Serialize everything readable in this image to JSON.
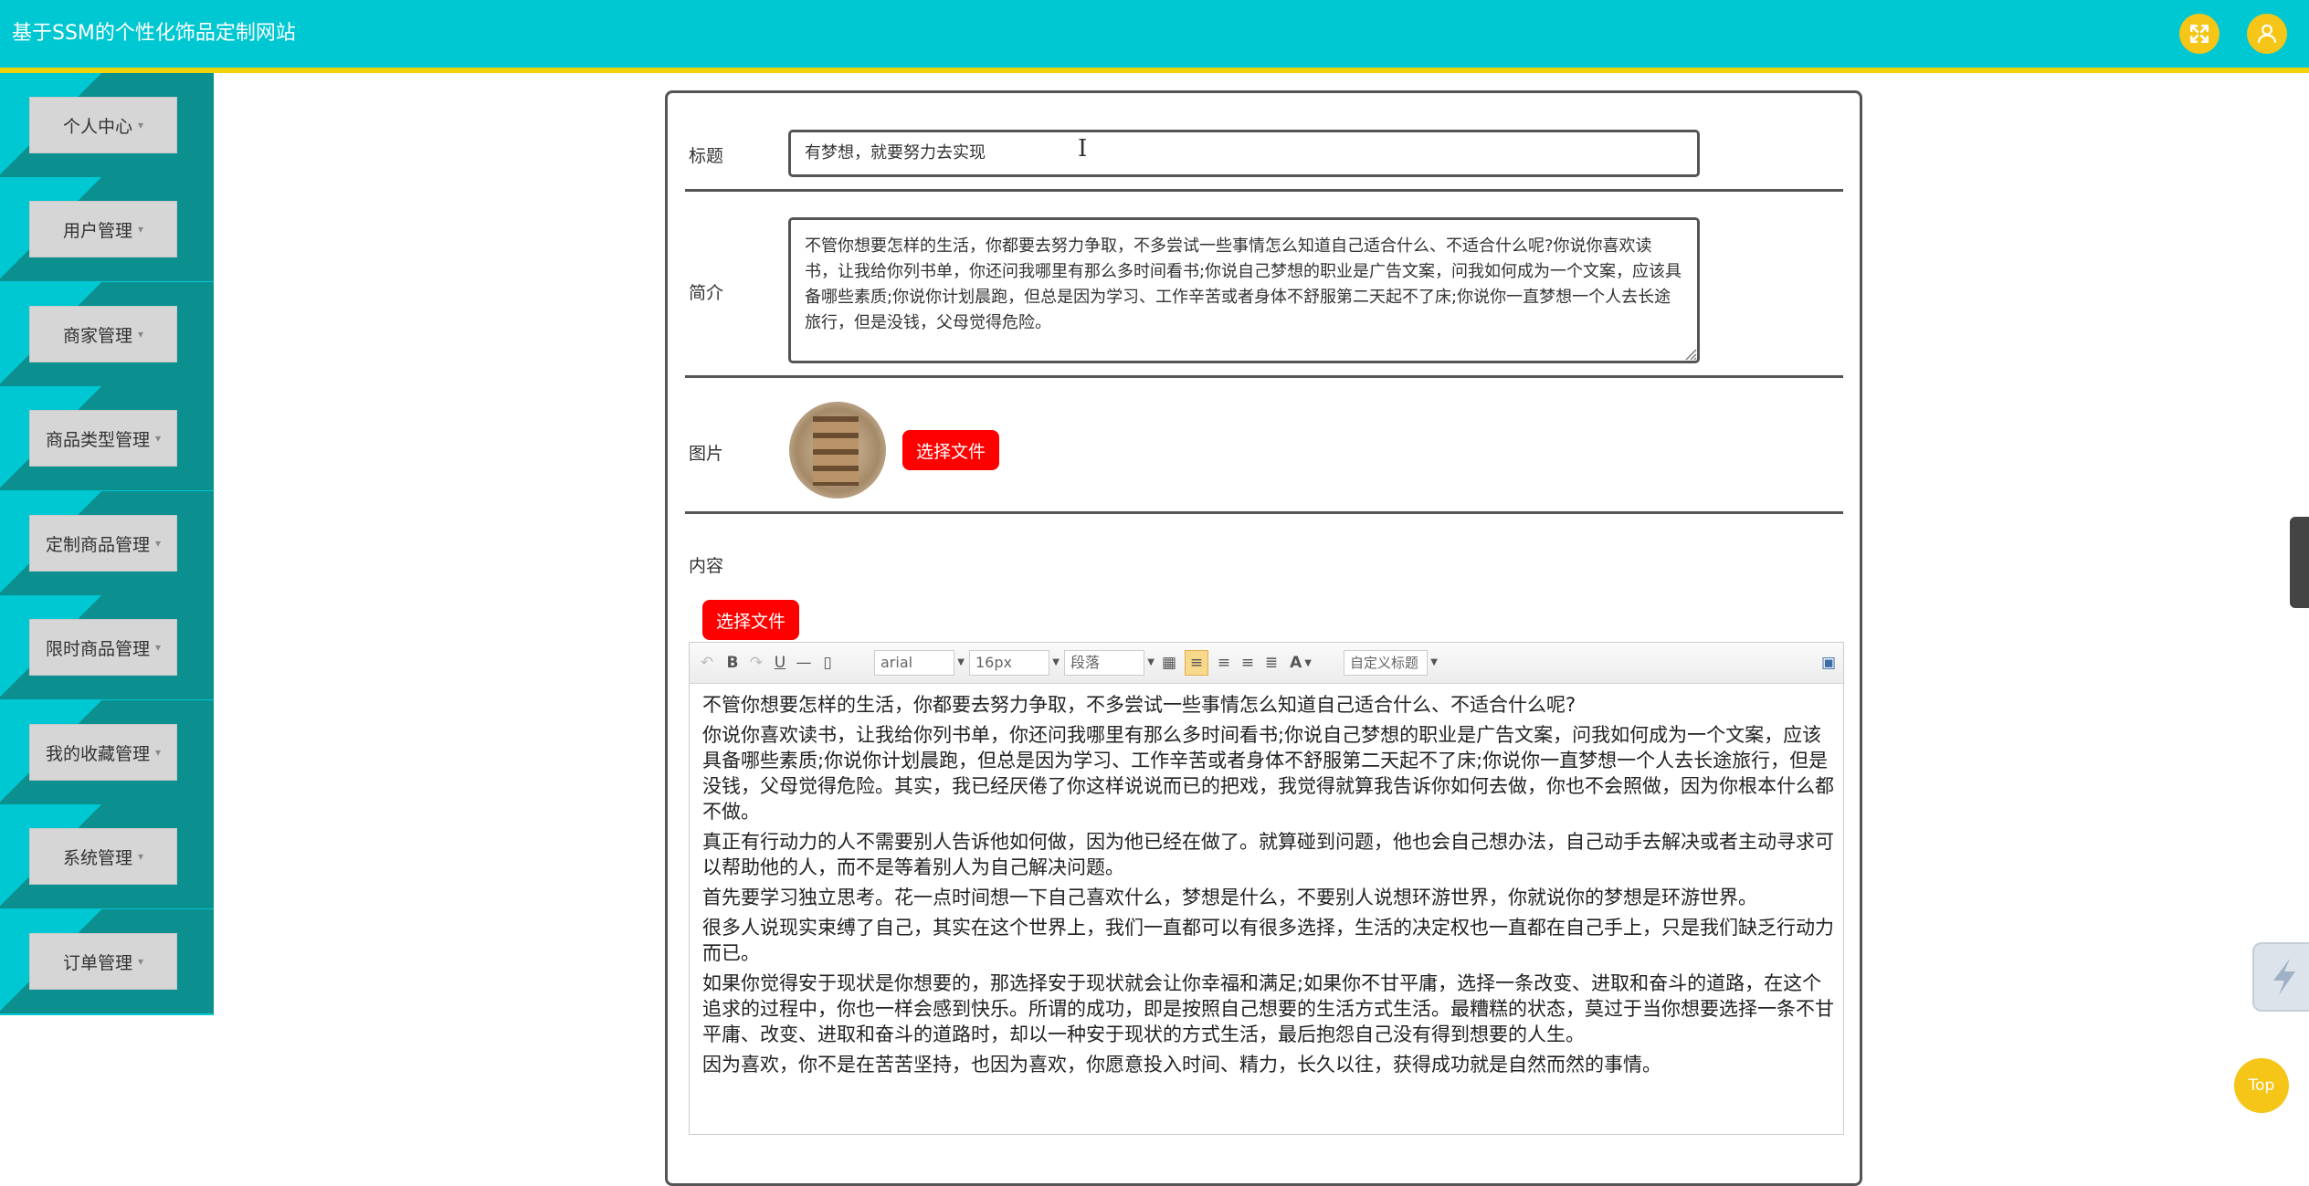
{
  "header": {
    "title": "基于SSM的个性化饰品定制网站",
    "fullscreen_icon": "fullscreen-icon",
    "user_icon": "user-icon",
    "colors": {
      "bar": "#00c8d2",
      "accent_line": "#f0d20a",
      "icon_bg": "#f5c518"
    }
  },
  "sidebar": {
    "items": [
      {
        "label": "个人中心"
      },
      {
        "label": "用户管理"
      },
      {
        "label": "商家管理"
      },
      {
        "label": "商品类型管理"
      },
      {
        "label": "定制商品管理"
      },
      {
        "label": "限时商品管理"
      },
      {
        "label": "我的收藏管理"
      },
      {
        "label": "系统管理"
      },
      {
        "label": "订单管理"
      }
    ],
    "caret": "▾"
  },
  "form": {
    "title_label": "标题",
    "title_value": "有梦想，就要努力去实现",
    "intro_label": "简介",
    "intro_value": "不管你想要怎样的生活，你都要去努力争取，不多尝试一些事情怎么知道自己适合什么、不适合什么呢?你说你喜欢读书，让我给你列书单，你还问我哪里有那么多时间看书;你说自己梦想的职业是广告文案，问我如何成为一个文案，应该具备哪些素质;你说你计划晨跑，但总是因为学习、工作辛苦或者身体不舒服第二天起不了床;你说你一直梦想一个人去长途旅行，但是没钱，父母觉得危险。",
    "image_label": "图片",
    "image_button": "选择文件",
    "content_label": "内容",
    "content_button": "选择文件"
  },
  "editor": {
    "toolbar": {
      "font_family": "arial",
      "font_size": "16px",
      "paragraph": "段落",
      "custom_title": "自定义标题"
    },
    "paragraphs": [
      "不管你想要怎样的生活，你都要去努力争取，不多尝试一些事情怎么知道自己适合什么、不适合什么呢?",
      "你说你喜欢读书，让我给你列书单，你还问我哪里有那么多时间看书;你说自己梦想的职业是广告文案，问我如何成为一个文案，应该具备哪些素质;你说你计划晨跑，但总是因为学习、工作辛苦或者身体不舒服第二天起不了床;你说你一直梦想一个人去长途旅行，但是没钱，父母觉得危险。其实，我已经厌倦了你这样说说而已的把戏，我觉得就算我告诉你如何去做，你也不会照做，因为你根本什么都不做。",
      "真正有行动力的人不需要别人告诉他如何做，因为他已经在做了。就算碰到问题，他也会自己想办法，自己动手去解决或者主动寻求可以帮助他的人，而不是等着别人为自己解决问题。",
      "首先要学习独立思考。花一点时间想一下自己喜欢什么，梦想是什么，不要别人说想环游世界，你就说你的梦想是环游世界。",
      "很多人说现实束缚了自己，其实在这个世界上，我们一直都可以有很多选择，生活的决定权也一直都在自己手上，只是我们缺乏行动力而已。",
      "如果你觉得安于现状是你想要的，那选择安于现状就会让你幸福和满足;如果你不甘平庸，选择一条改变、进取和奋斗的道路，在这个追求的过程中，你也一样会感到快乐。所谓的成功，即是按照自己想要的生活方式生活。最糟糕的状态，莫过于当你想要选择一条不甘平庸、改变、进取和奋斗的道路时，却以一种安于现状的方式生活，最后抱怨自己没有得到想要的人生。",
      "因为喜欢，你不是在苦苦坚持，也因为喜欢，你愿意投入时间、精力，长久以往，获得成功就是自然而然的事情。"
    ]
  },
  "floating": {
    "top_label": "Top"
  }
}
